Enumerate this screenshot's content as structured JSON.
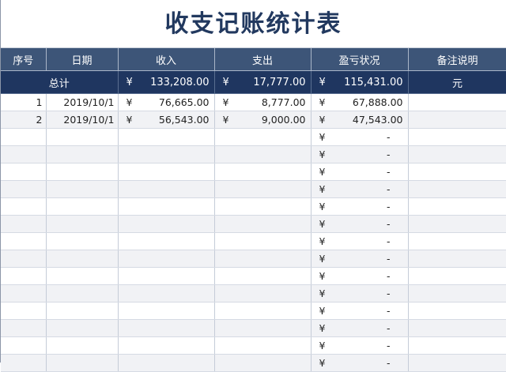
{
  "title": "收支记账统计表",
  "headers": [
    "序号",
    "日期",
    "收入",
    "支出",
    "盈亏状况",
    "备注说明"
  ],
  "totals": {
    "label": "总计",
    "currency": "¥",
    "income": "133,208.00",
    "expense": "17,777.00",
    "profit": "115,431.00",
    "note": "元"
  },
  "rows": [
    {
      "no": "1",
      "date": "2019/10/1",
      "cur": "¥",
      "income": "76,665.00",
      "expense": "8,777.00",
      "profit": "67,888.00"
    },
    {
      "no": "2",
      "date": "2019/10/1",
      "cur": "¥",
      "income": "56,543.00",
      "expense": "9,000.00",
      "profit": "47,543.00"
    }
  ],
  "empty_row": {
    "cur": "¥",
    "profit": "-"
  },
  "empty_row_count": 14,
  "colors": {
    "header_bg": "#3d5578",
    "total_bg": "#1f3660",
    "title": "#22395f"
  }
}
